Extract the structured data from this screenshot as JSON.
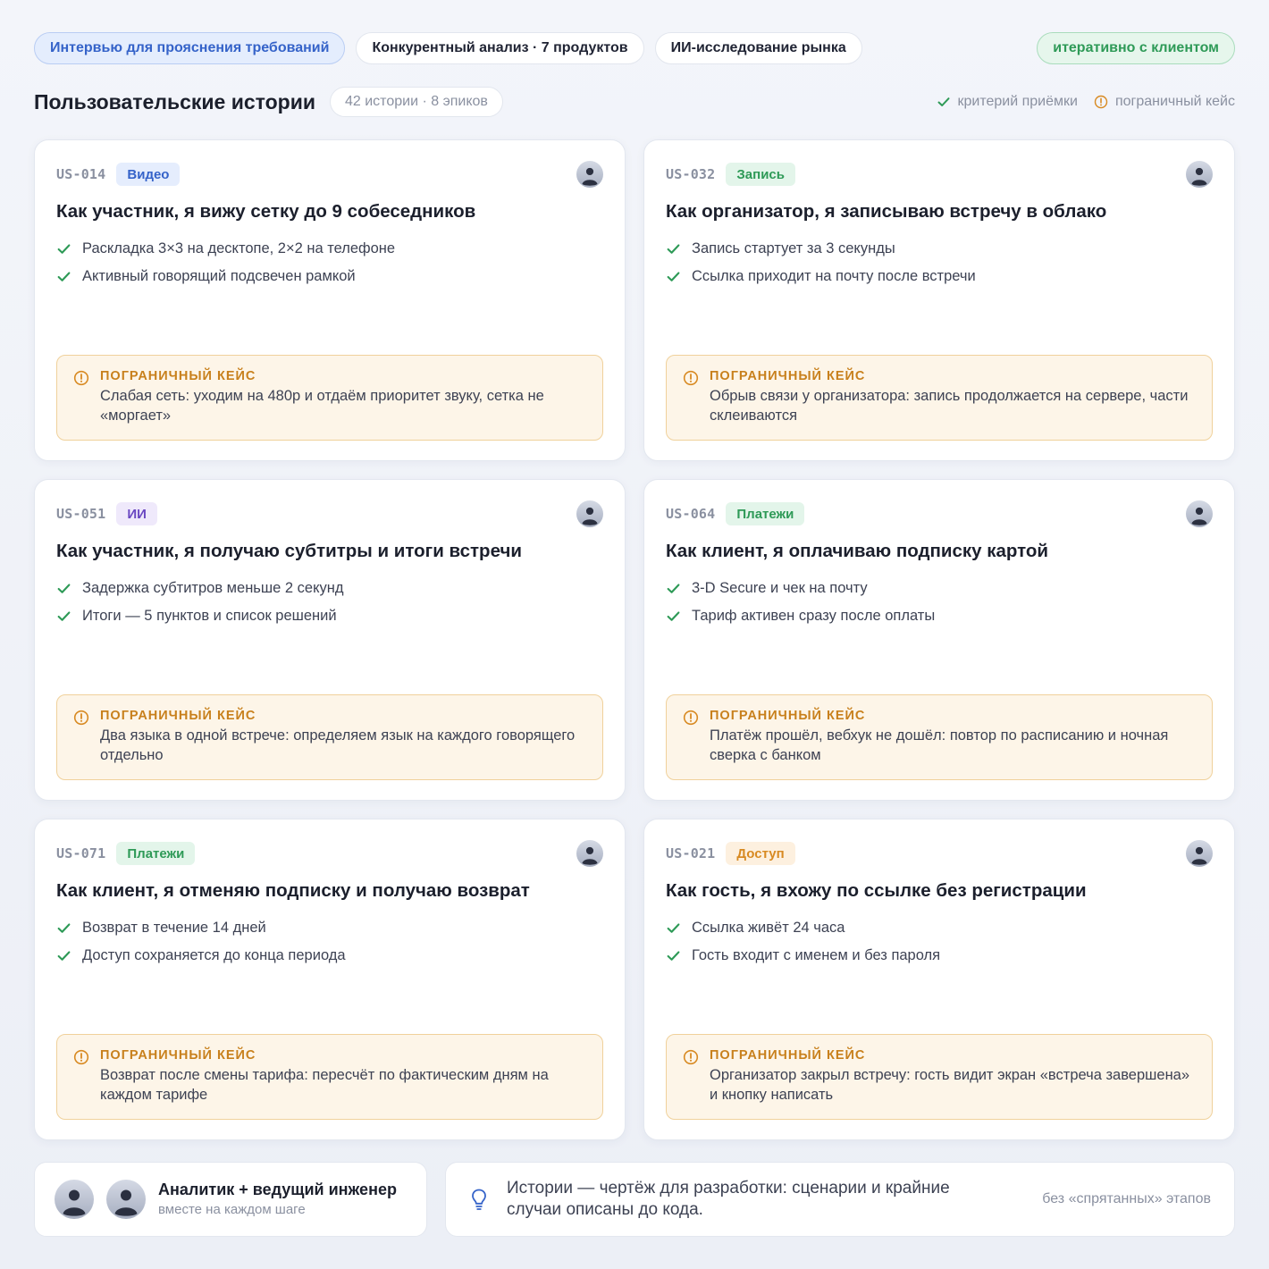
{
  "topbar": {
    "pills": [
      {
        "label": "Интервью для прояснения требований"
      },
      {
        "label": "Конкурентный анализ · 7 продуктов"
      },
      {
        "label": "ИИ-исследование рынка"
      }
    ],
    "status": "итеративно с клиентом"
  },
  "header": {
    "title": "Пользовательские истории",
    "count": "42 истории · 8 эпиков",
    "legend": {
      "criterion": "критерий приёмки",
      "edge_case": "пограничный кейс"
    }
  },
  "colors": {
    "accent_blue": "#3563c9",
    "success_green": "#2e9a57",
    "warning_orange": "#d88a22",
    "ai_purple": "#6a48c2"
  },
  "edge_label": "ПОГРАНИЧНЫЙ КЕЙС",
  "stories": [
    {
      "id": "US-014",
      "tag": "Видео",
      "title": "Как участник, я вижу сетку до 9 собеседников",
      "criteria": [
        "Раскладка 3×3 на десктопе, 2×2 на телефоне",
        "Активный говорящий подсвечен рамкой"
      ],
      "edge_case": "Слабая сеть: уходим на 480p и отдаём приоритет звуку, сетка не «моргает»"
    },
    {
      "id": "US-032",
      "tag": "Запись",
      "title": "Как организатор, я записываю встречу в облако",
      "criteria": [
        "Запись стартует за 3 секунды",
        "Ссылка приходит на почту после встречи"
      ],
      "edge_case": "Обрыв связи у организатора: запись продолжается на сервере, части склеиваются"
    },
    {
      "id": "US-051",
      "tag": "ИИ",
      "title": "Как участник, я получаю субтитры и итоги встречи",
      "criteria": [
        "Задержка субтитров меньше 2 секунд",
        "Итоги — 5 пунктов и список решений"
      ],
      "edge_case": "Два языка в одной встрече: определяем язык на каждого говорящего отдельно"
    },
    {
      "id": "US-064",
      "tag": "Платежи",
      "title": "Как клиент, я оплачиваю подписку картой",
      "criteria": [
        "3-D Secure и чек на почту",
        "Тариф активен сразу после оплаты"
      ],
      "edge_case": "Платёж прошёл, вебхук не дошёл: повтор по расписанию и ночная сверка с банком"
    },
    {
      "id": "US-071",
      "tag": "Платежи",
      "title": "Как клиент, я отменяю подписку и получаю возврат",
      "criteria": [
        "Возврат в течение 14 дней",
        "Доступ сохраняется до конца периода"
      ],
      "edge_case": "Возврат после смены тарифа: пересчёт по фактическим дням на каждом тарифе"
    },
    {
      "id": "US-021",
      "tag": "Доступ",
      "title": "Как гость, я вхожу по ссылке без регистрации",
      "criteria": [
        "Ссылка живёт 24 часа",
        "Гость входит с именем и без пароля"
      ],
      "edge_case": "Организатор закрыл встречу: гость видит экран «встреча завершена» и кнопку написать"
    }
  ],
  "footer": {
    "team": "Аналитик + ведущий инженер",
    "team_sub": "вместе на каждом шаге",
    "note": "Истории — чертёж для разработки: сценарии и крайние случаи описаны до кода.",
    "note_side": "без «спрятанных» этапов"
  }
}
